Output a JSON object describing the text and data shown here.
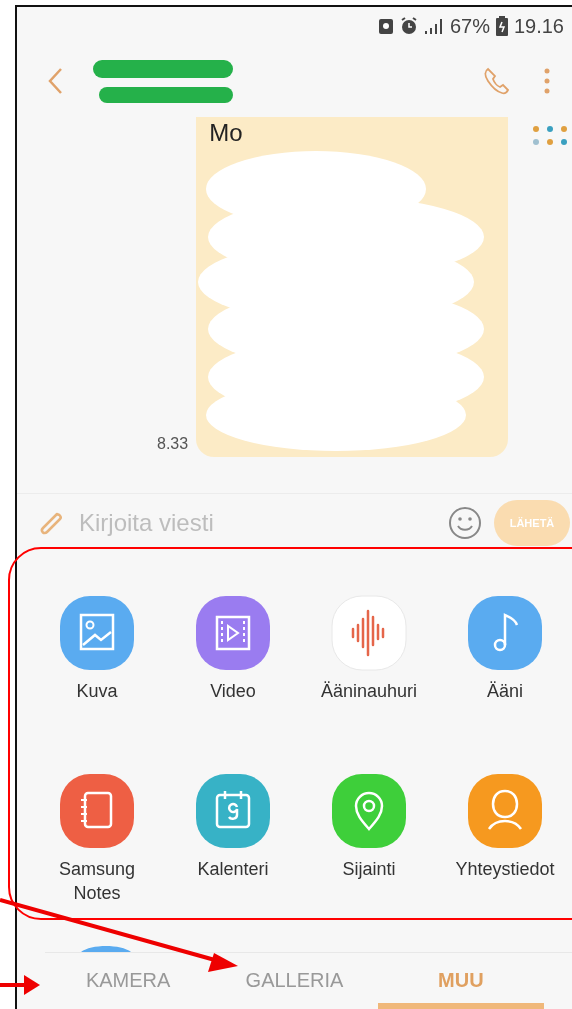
{
  "status_bar": {
    "battery": "67%",
    "time": "19.16"
  },
  "message": {
    "text": "Mo",
    "time": "8.33"
  },
  "compose": {
    "placeholder": "Kirjoita viesti",
    "send": "LÄHETÄ",
    "send_disabled": true
  },
  "attachments": [
    {
      "label": "Kuva",
      "kind": "image",
      "color": "#5aabf0"
    },
    {
      "label": "Video",
      "kind": "video",
      "color": "#9a7cf0"
    },
    {
      "label": "Ääninauhuri",
      "kind": "recorder",
      "color": "#ffffff"
    },
    {
      "label": "Ääni",
      "kind": "audio",
      "color": "#5aabf0"
    },
    {
      "label": "Samsung Notes",
      "kind": "notes",
      "color": "#ee5f44"
    },
    {
      "label": "Kalenteri",
      "kind": "calendar",
      "color": "#37b2c6"
    },
    {
      "label": "Sijainti",
      "kind": "location",
      "color": "#3ecf3a"
    },
    {
      "label": "Yhteystiedot",
      "kind": "contacts",
      "color": "#f6991f"
    }
  ],
  "tabs": [
    {
      "label": "KAMERA",
      "selected": false
    },
    {
      "label": "GALLERIA",
      "selected": false
    },
    {
      "label": "MUU",
      "selected": true
    }
  ]
}
